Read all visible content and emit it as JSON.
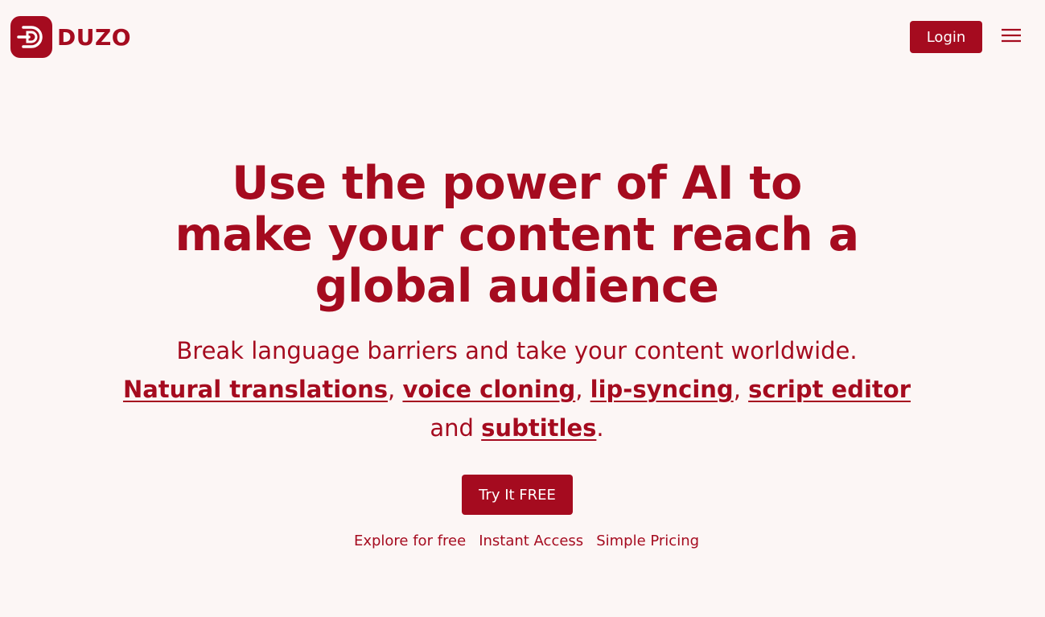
{
  "brand": {
    "name": "DUZO",
    "color": "#a50b1f"
  },
  "header": {
    "login_label": "Login",
    "menu_icon": "hamburger-menu-icon"
  },
  "hero": {
    "title": "Use the power of AI to make your content reach a global audience",
    "subtitle": "Break language barriers and take your content worldwide.",
    "features": {
      "items": [
        "Natural translations",
        "voice cloning",
        "lip-syncing",
        "script editor",
        "subtitles"
      ],
      "sep": ", ",
      "and": "and ",
      "end": "."
    },
    "cta_label": "Try It FREE",
    "perks": [
      "Explore for free",
      "Instant Access",
      "Simple Pricing"
    ]
  }
}
